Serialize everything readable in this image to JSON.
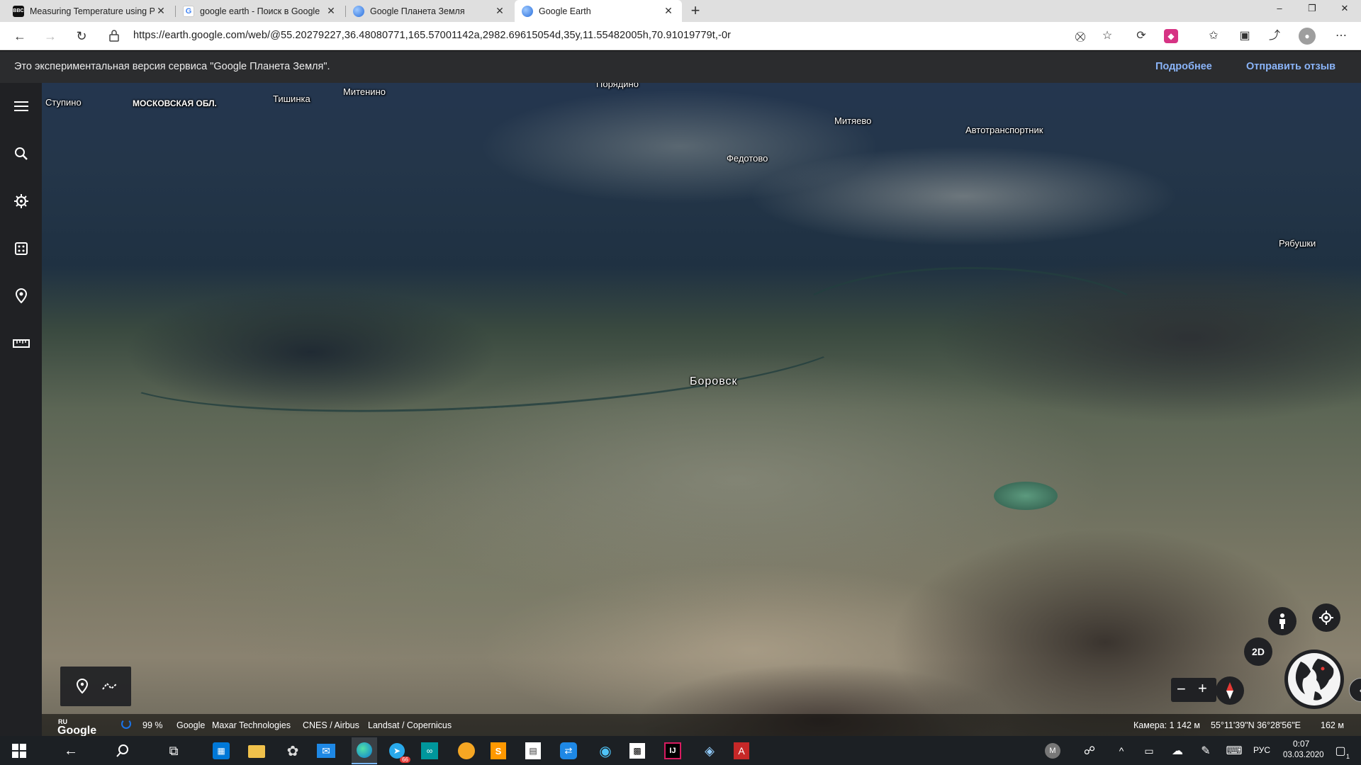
{
  "browser": {
    "tabs": [
      {
        "title": "Measuring Temperature using Pi",
        "favicon": "bbc-icon"
      },
      {
        "title": "google earth - Поиск в Google",
        "favicon": "google-icon"
      },
      {
        "title": "Google Планета Земля",
        "favicon": "earth-icon"
      },
      {
        "title": "Google Earth",
        "favicon": "earth-icon"
      }
    ],
    "active_tab": 3,
    "url": "https://earth.google.com/web/@55.20279227,36.48080771,165.57001142a,2982.69615054d,35y,11.55482005h,70.91019779t,-0r"
  },
  "infobar": {
    "message": "Это экспериментальная версия сервиса \"Google Планета Земля\".",
    "more_link": "Подробнее",
    "feedback_link": "Отправить отзыв"
  },
  "map": {
    "places": {
      "stupino": "Ступино",
      "moscow_region": "МОСКОВСКАЯ ОБЛ.",
      "tishinka": "Тишинка",
      "mitenino": "Митенино",
      "poryadino": "Порядино",
      "mityaevo": "Митяево",
      "avtotransportnik": "Автотранспортник",
      "fedotovo": "Федотово",
      "ryabushki": "Рябушки",
      "borovsk": "Боровск"
    },
    "controls": {
      "mode_2d": "2D"
    }
  },
  "attribution": {
    "google_logo": "Google",
    "region": "RU",
    "loading_percent": "99 %",
    "sources": [
      "Google",
      "Maxar Technologies",
      "CNES / Airbus",
      "Landsat / Copernicus"
    ],
    "camera": "Камера: 1 142 м",
    "coordinates": "55°11'39\"N 36°28'56\"E",
    "elevation": "162 м"
  },
  "taskbar": {
    "language": "РУС",
    "time": "0:07",
    "date": "03.03.2020",
    "telegram_badge": "66",
    "notifications": "1",
    "user_initial": "M"
  }
}
